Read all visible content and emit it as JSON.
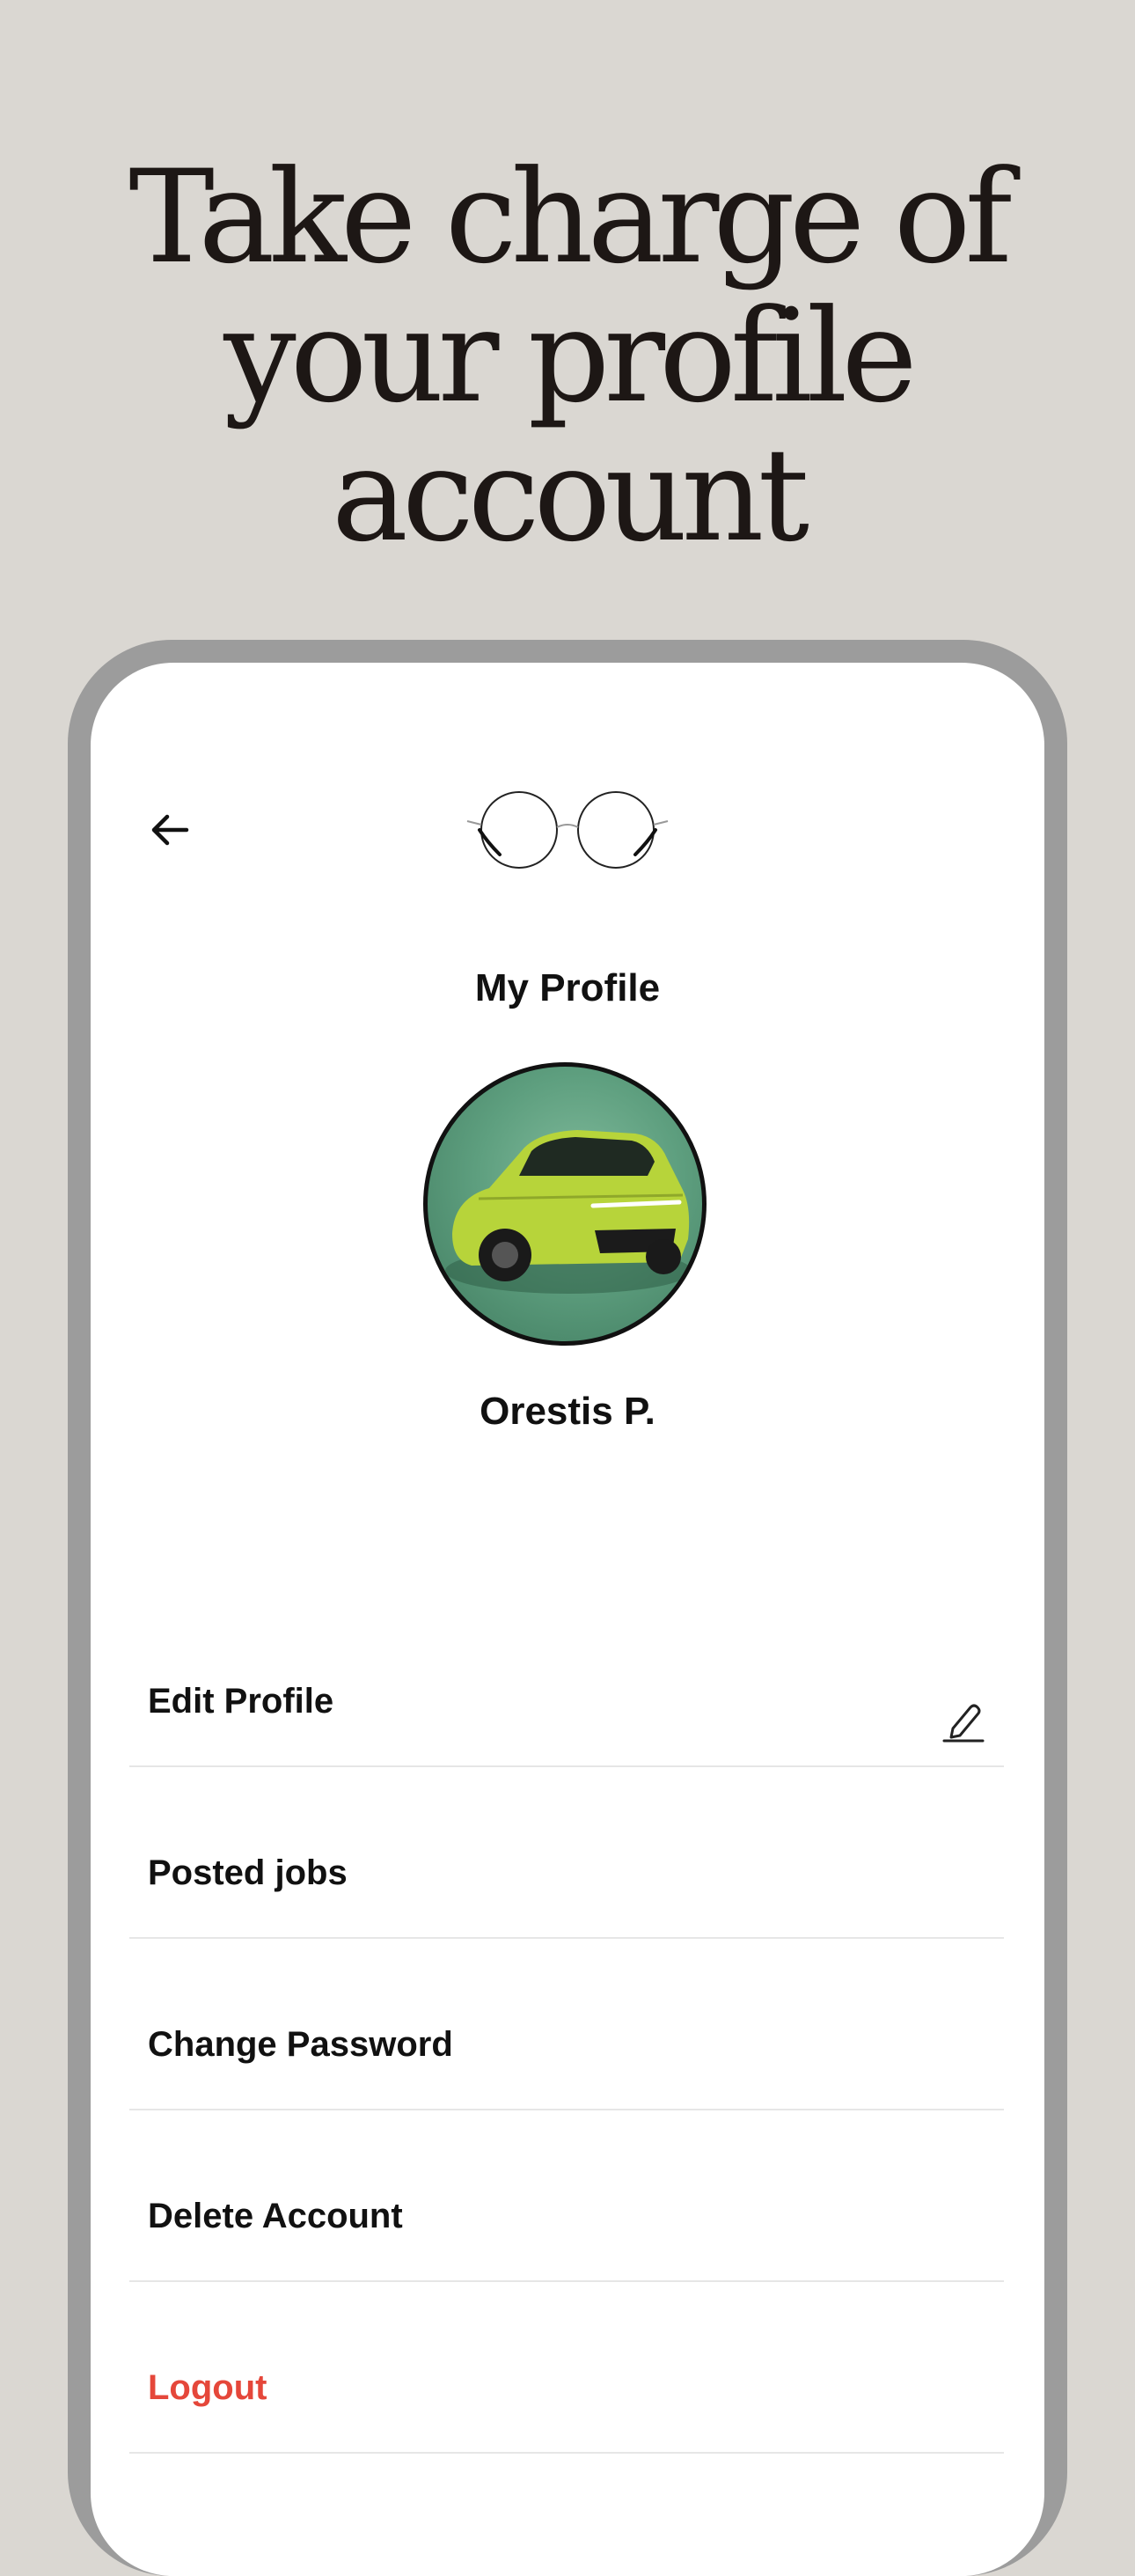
{
  "headline": {
    "line1": "Take charge of",
    "line2": "your profile",
    "line3": "account"
  },
  "header": {
    "back_icon": "arrow-left-icon",
    "logo_icon": "round-glasses-logo"
  },
  "profile": {
    "title": "My Profile",
    "name": "Orestis P.",
    "avatar": "green-suv-photo"
  },
  "menu": {
    "items": [
      {
        "label": "Edit Profile",
        "icon": "pencil-icon"
      },
      {
        "label": "Posted jobs"
      },
      {
        "label": "Change Password"
      },
      {
        "label": "Delete Account"
      },
      {
        "label": "Logout",
        "color": "#e5473a"
      }
    ]
  },
  "colors": {
    "background": "#dad7d2",
    "frame": "#9c9c9c",
    "danger": "#e5473a"
  }
}
